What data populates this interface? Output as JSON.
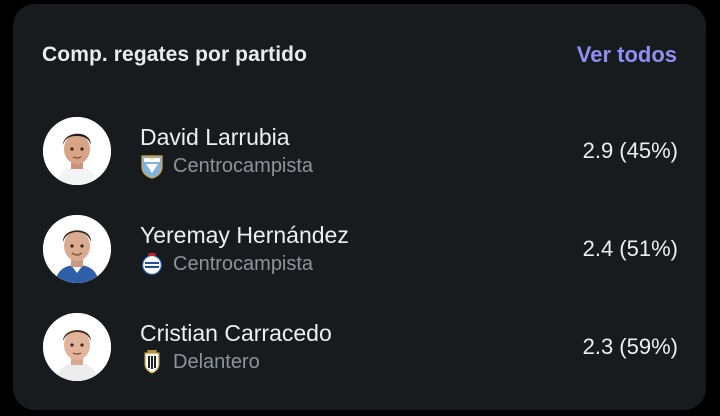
{
  "card": {
    "title": "Comp. regates por partido",
    "view_all_label": "Ver todos"
  },
  "players": [
    {
      "name": "David Larrubia",
      "position": "Centrocampista",
      "team_crest_icon": "malaga-crest-icon",
      "stat": "2.9 (45%)"
    },
    {
      "name": "Yeremay Hernández",
      "position": "Centrocampista",
      "team_crest_icon": "deportivo-crest-icon",
      "stat": "2.4 (51%)"
    },
    {
      "name": "Cristian Carracedo",
      "position": "Delantero",
      "team_crest_icon": "albacete-crest-icon",
      "stat": "2.3 (59%)"
    }
  ],
  "colors": {
    "card_background": "#181b1e",
    "accent": "#8f8ff2",
    "primary_text": "#eceff1",
    "secondary_text": "#8e9398"
  }
}
